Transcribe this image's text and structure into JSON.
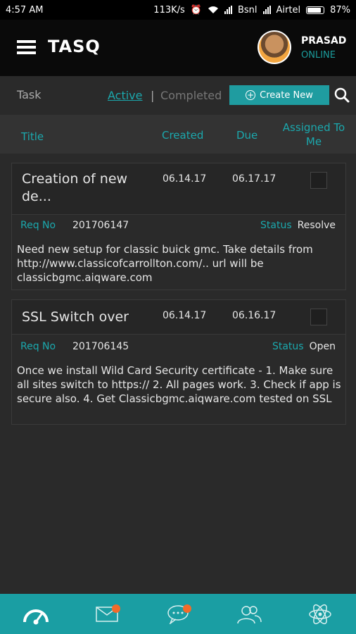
{
  "status_bar": {
    "time": "4:57 AM",
    "speed": "113K/s",
    "carrier1": "Bsnl",
    "carrier2": "Airtel",
    "battery": "87%"
  },
  "header": {
    "logo": "TASQ",
    "user_name": "PRASAD",
    "user_status": "ONLINE"
  },
  "tabs": {
    "task_label": "Task",
    "active": "Active",
    "separator": "|",
    "completed": "Completed",
    "create_button": "Create New"
  },
  "columns": {
    "title": "Title",
    "created": "Created",
    "due": "Due",
    "assigned": "Assigned To Me"
  },
  "tasks": [
    {
      "title": "Creation of new de...",
      "created": "06.14.17",
      "due": "06.17.17",
      "req_label": "Req No",
      "req_no": "201706147",
      "status_label": "Status",
      "status": "Resolve",
      "description": "Need new setup for classic buick gmc. Take details from http://www.classicofcarrollton.com/.. url will be classicbgmc.aiqware.com"
    },
    {
      "title": "SSL Switch over",
      "created": "06.14.17",
      "due": "06.16.17",
      "req_label": "Req No",
      "req_no": "201706145",
      "status_label": "Status",
      "status": "Open",
      "description": "Once we install Wild Card Security certificate - 1. Make sure all sites switch to https:// 2. All pages work. 3. Check if app is secure also. 4. Get Classicbgmc.aiqware.com tested on SSL"
    }
  ],
  "colors": {
    "accent": "#1ba8ad",
    "nav_bg": "#1a9ea3",
    "badge": "#f26b2a"
  },
  "bottom_nav": [
    {
      "icon": "dashboard-icon"
    },
    {
      "icon": "mail-icon",
      "badge": true
    },
    {
      "icon": "chat-icon",
      "badge": true
    },
    {
      "icon": "users-icon"
    },
    {
      "icon": "atom-icon"
    }
  ]
}
